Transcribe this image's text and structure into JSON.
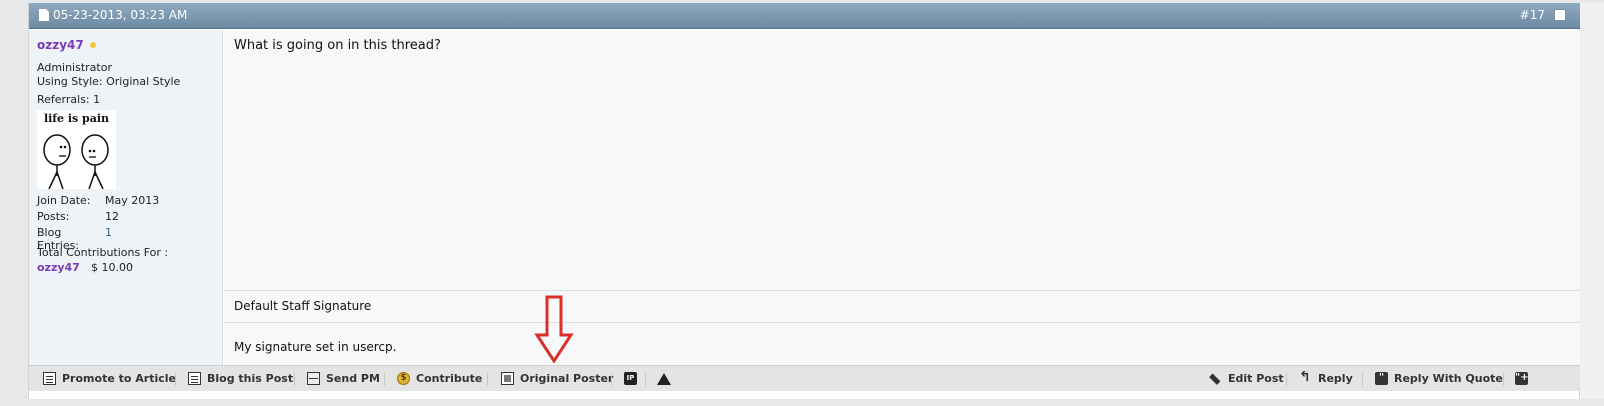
{
  "header": {
    "date": "05-23-2013, 03:23 AM",
    "post_number": "#17"
  },
  "user": {
    "name": "ozzy47",
    "title": "Administrator",
    "style": "Using Style: Original Style",
    "referrals": "Referrals: 1",
    "avatar_caption": "life is pain",
    "stats": [
      {
        "label": "Join Date:",
        "value": "May 2013"
      },
      {
        "label": "Posts:",
        "value": "12"
      },
      {
        "label": "Blog Entries:",
        "value": "1"
      }
    ],
    "contributions_label": "Total Contributions For :",
    "contributions_user": "ozzy47",
    "contributions_amount": "$ 10.00"
  },
  "post": {
    "message": "What is going on in this thread?",
    "signature_title": "Default Staff Signature",
    "signature_text": "My signature set in usercp."
  },
  "footer": {
    "promote": "Promote to Article",
    "blog": "Blog this Post",
    "send_pm": "Send PM",
    "contribute": "Contribute",
    "original_poster": "Original Poster",
    "ip_badge": "IP",
    "edit_post": "Edit Post",
    "reply": "Reply",
    "reply_with_quote": "Reply With Quote"
  },
  "colors": {
    "header_bar": "#7b98b1",
    "username": "#7c3ab8",
    "annotation_arrow": "#d9302c",
    "status_online": "#f4c542"
  },
  "icons": [
    "document-icon",
    "checkbox-icon",
    "status-dot-icon",
    "annotation-down-arrow",
    "document-icon",
    "blog-icon",
    "envelope-icon",
    "coin-icon",
    "user-card-icon",
    "ip-icon",
    "warning-icon",
    "pencil-icon",
    "reply-arrow-icon",
    "quote-icon",
    "multiquote-icon"
  ]
}
